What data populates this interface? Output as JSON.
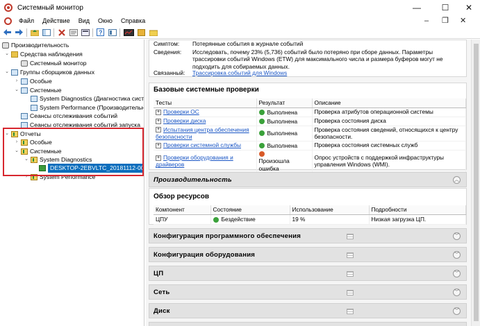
{
  "window": {
    "title": "Системный монитор",
    "minimize": "—",
    "maximize": "☐",
    "close": "✕"
  },
  "menu": {
    "items": [
      "Файл",
      "Действие",
      "Вид",
      "Окно",
      "Справка"
    ],
    "right": {
      "minimize": "–",
      "restore": "❐",
      "close": "✕"
    }
  },
  "toolbar": {
    "icons": [
      "back-icon",
      "forward-icon",
      "folder-up-icon",
      "show-hide-tree-icon",
      "delete-icon",
      "properties-icon",
      "export-icon",
      "help-icon",
      "view-icon",
      "report-icon",
      "folder-icon"
    ]
  },
  "tree": {
    "root": "Производительность",
    "monitoring_tools": "Средства наблюдения",
    "system_monitor": "Системный монитор",
    "collector_sets": "Группы сборщиков данных",
    "cs_user": "Особые",
    "cs_system": "Системные",
    "cs_sys_diag": "System Diagnostics (Диагностика сист",
    "cs_sys_perf": "System Performance (Производительн",
    "event_trace": "Сеансы отслеживания событий",
    "startup_trace": "Сеансы отслеживания событий запуска",
    "reports": "Отчеты",
    "r_user": "Особые",
    "r_system": "Системные",
    "r_sys_diag": "System Diagnostics",
    "r_report_item": "DESKTOP-2EBVLTC_20181112-00000",
    "r_sys_perf": "System Performance"
  },
  "summary": {
    "symptom_label": "Симптом:",
    "symptom_value": "Потерянные события в журнале событий",
    "details_label": "Сведения:",
    "details_value": "Исследовать, почему 23% (5,736) событий было потеряно при сборе данных. Параметры трассировки событий Windows (ETW) для максимального числа и размера буферов могут не подходить для собираемых данных.",
    "related_label": "Связанный:",
    "related_value": "Трассировка событий для Windows"
  },
  "basic_checks": {
    "title": "Базовые системные проверки",
    "columns": [
      "Тесты",
      "Результат",
      "Описание"
    ],
    "rows": [
      {
        "test": "Проверки ОС",
        "result": "Выполнена",
        "status": "pass",
        "desc": "Проверка атрибутов операционной системы"
      },
      {
        "test": "Проверки диска",
        "result": "Выполнена",
        "status": "pass",
        "desc": "Проверка состояния диска"
      },
      {
        "test": "Испытания центра обеспечения безопасности",
        "result": "Выполнена",
        "status": "pass",
        "desc": "Проверка состояния сведений, относящихся к центру безопасности."
      },
      {
        "test": "Проверки системной службы",
        "result": "Выполнена",
        "status": "pass",
        "desc": "Проверка состояния системных служб"
      },
      {
        "test": "Проверки оборудования и драйверов",
        "result": "Произошла ошибка",
        "status": "fail",
        "desc": "Опрос устройств с поддержкой инфраструктуры управления Windows (WMI)."
      }
    ]
  },
  "performance": {
    "bar_label": "Производительность",
    "overview_title": "Обзор ресурсов",
    "columns": [
      "Компонент",
      "Состояние",
      "Использование",
      "Подробности"
    ],
    "rows": [
      {
        "component": "ЦПУ",
        "state": "Бездействие",
        "usage": "19 %",
        "details": "Низкая загрузка ЦП."
      }
    ]
  },
  "sections": [
    "Конфигурация программного обеспечения",
    "Конфигурация оборудования",
    "ЦП",
    "Сеть",
    "Диск"
  ],
  "colors": {
    "pass": "#3aa13a",
    "fail": "#d85a28",
    "selection": "#0a6ebd",
    "highlight": "#d7262e",
    "link": "#1a56c5"
  }
}
